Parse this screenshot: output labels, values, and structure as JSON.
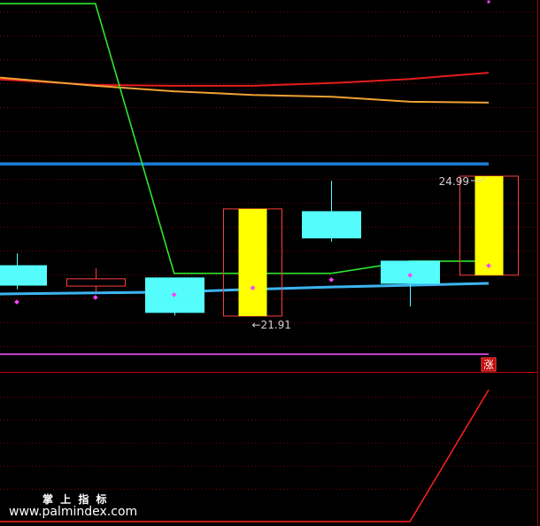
{
  "watermark": {
    "title": "掌 上 指 标",
    "url": "www.palmindex.com"
  },
  "chart_data": [
    {
      "type": "candlestick",
      "ylim": [
        20.68,
        28.87
      ],
      "grid": true,
      "up_color": "#ff3c3c",
      "down_color": "#54fcfc",
      "candles": [
        {
          "open": 23.02,
          "high": 23.29,
          "low": 22.5,
          "close": 22.59
        },
        {
          "open": 22.57,
          "high": 22.96,
          "low": 22.44,
          "close": 22.73
        },
        {
          "open": 22.75,
          "high": 22.75,
          "low": 21.92,
          "close": 21.99
        },
        {
          "open": 21.91,
          "high": 24.27,
          "low": 21.91,
          "close": 24.27
        },
        {
          "open": 24.21,
          "high": 24.89,
          "low": 23.55,
          "close": 23.63
        },
        {
          "open": 23.12,
          "high": 23.12,
          "low": 22.12,
          "close": 22.63
        },
        {
          "open": 22.81,
          "high": 24.99,
          "low": 22.81,
          "close": 24.99
        }
      ],
      "sticks": {
        "color": "#ffff00",
        "bars": [
          {
            "index": 3,
            "from": 21.91,
            "to": 24.27
          },
          {
            "index": 6,
            "from": 22.81,
            "to": 24.99
          }
        ]
      },
      "lines": [
        {
          "color": "#e41c1c",
          "values": [
            27.1,
            27.0,
            26.98,
            26.98,
            27.04,
            27.13,
            27.27
          ]
        },
        {
          "color": "#f0a234",
          "values": [
            27.13,
            26.98,
            26.86,
            26.78,
            26.74,
            26.63,
            26.61
          ]
        },
        {
          "color": "#2ee62e",
          "values": [
            28.79,
            28.79,
            22.85,
            22.85,
            22.85,
            23.12,
            23.12
          ]
        },
        {
          "color": "#3cb4f0",
          "values": [
            22.4,
            22.42,
            22.44,
            22.5,
            22.55,
            22.59,
            22.63
          ]
        }
      ],
      "hlines": [
        {
          "color": "#1c7fd6",
          "value": 25.26
        },
        {
          "color": "#c040c8",
          "value": 21.07
        }
      ],
      "points": {
        "color": "#ff40ff",
        "values": [
          22.22,
          22.32,
          22.38,
          22.53,
          22.71,
          22.81,
          23.02
        ]
      },
      "top_marker": {
        "color": "#ff40ff",
        "index": 6,
        "value": 28.83
      },
      "high_label": {
        "text": "24.99",
        "index": 6,
        "value": 24.99
      },
      "low_label": {
        "text": "←21.91",
        "index": 3,
        "value": 21.91
      },
      "signal": {
        "text": "涨",
        "index": 6,
        "color": "#c00000"
      }
    },
    {
      "type": "line",
      "ylim": [
        0,
        100
      ],
      "grid": true,
      "lines": [
        {
          "color": "#ff2020",
          "values": [
            0,
            0,
            0,
            0,
            0,
            0,
            88
          ]
        }
      ]
    }
  ]
}
